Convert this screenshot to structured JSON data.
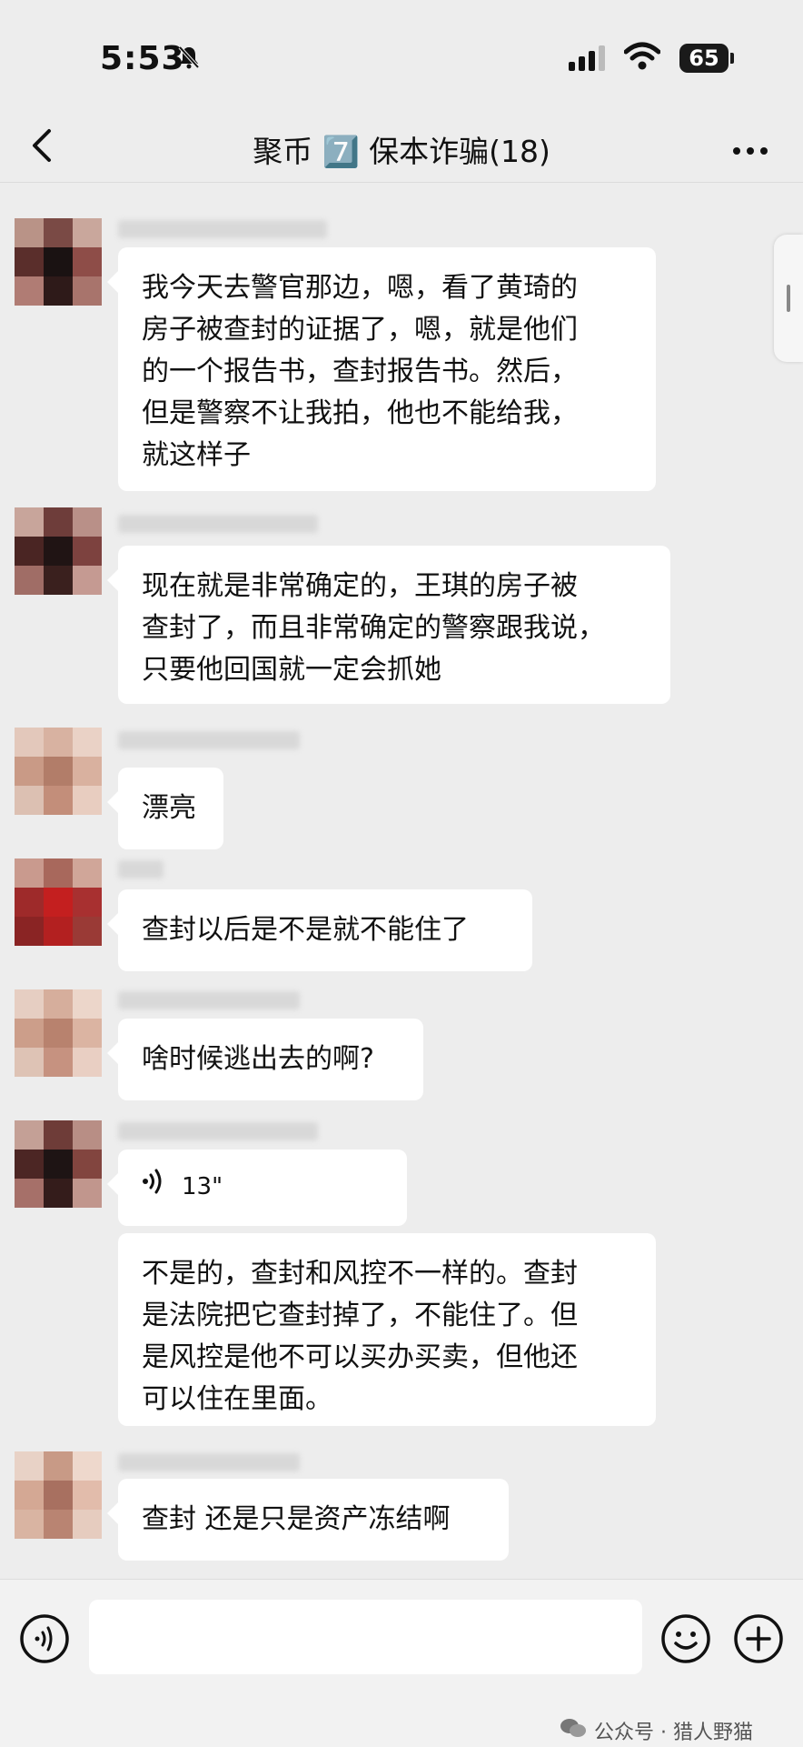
{
  "status_bar": {
    "time": "5:53",
    "battery": "65"
  },
  "header": {
    "back_icon": "chevron-left-icon",
    "title": "聚币 7️⃣ 保本诈骗(18)",
    "more_icon": "ellipsis-icon"
  },
  "messages": [
    {
      "text": "我今天去警官那边，嗯，看了黄琦的\n房子被查封的证据了，嗯，就是他们\n的一个报告书，查封报告书。然后，\n但是警察不让我拍，他也不能给我，\n就这样子"
    },
    {
      "text": "现在就是非常确定的，王琪的房子被\n查封了，而且非常确定的警察跟我说，\n只要他回国就一定会抓她"
    },
    {
      "text": "漂亮"
    },
    {
      "text": "查封以后是不是就不能住了"
    },
    {
      "text": "啥时候逃出去的啊?"
    },
    {
      "voice_duration": "13\""
    },
    {
      "text": "不是的，查封和风控不一样的。查封\n是法院把它查封掉了，不能住了。但\n是风控是他不可以买办买卖，但他还\n可以住在里面。"
    },
    {
      "text": "查封 还是只是资产冻结啊"
    }
  ],
  "input_bar": {
    "placeholder": ""
  },
  "watermark": {
    "text": "公众号 · 猎人野猫"
  },
  "colors": {
    "background": "#ededed",
    "bubble": "#ffffff"
  }
}
